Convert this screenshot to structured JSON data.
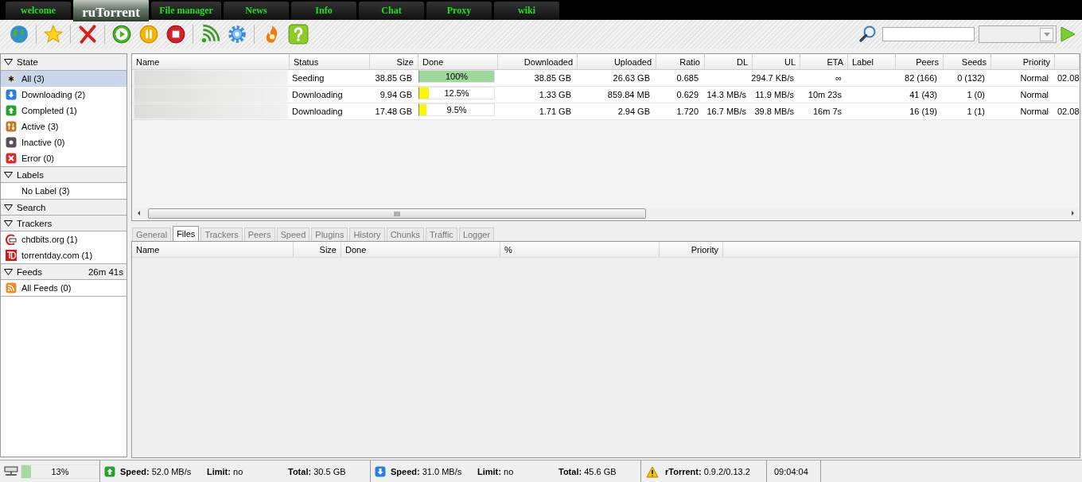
{
  "top_tabs": [
    {
      "label": "welcome",
      "selected": false
    },
    {
      "label": "ruTorrent",
      "selected": true
    },
    {
      "label": "File manager",
      "selected": false
    },
    {
      "label": "News",
      "selected": false
    },
    {
      "label": "Info",
      "selected": false
    },
    {
      "label": "Chat",
      "selected": false
    },
    {
      "label": "Proxy",
      "selected": false
    },
    {
      "label": "wiki",
      "selected": false
    }
  ],
  "sidebar": [
    {
      "title": "State",
      "expanded": true,
      "items": [
        {
          "kind": "all",
          "label": "All (3)",
          "selected": true
        },
        {
          "kind": "downloading",
          "label": "Downloading (2)",
          "selected": false
        },
        {
          "kind": "completed",
          "label": "Completed (1)",
          "selected": false
        },
        {
          "kind": "active",
          "label": "Active (3)",
          "selected": false
        },
        {
          "kind": "inactive",
          "label": "Inactive (0)",
          "selected": false
        },
        {
          "kind": "error",
          "label": "Error (0)",
          "selected": false
        }
      ]
    },
    {
      "title": "Labels",
      "expanded": true,
      "items": [
        {
          "kind": "label",
          "label": "No Label (3)",
          "selected": false
        }
      ]
    },
    {
      "title": "Search",
      "expanded": true
    },
    {
      "title": "Trackers",
      "expanded": true,
      "items": [
        {
          "kind": "tracker-c",
          "label": "chdbits.org (1)",
          "selected": false
        },
        {
          "kind": "tracker-t",
          "label": "torrentday.com (1)",
          "selected": false
        }
      ]
    },
    {
      "title": "Feeds",
      "expanded": true,
      "timer": "26m 41s",
      "items": [
        {
          "kind": "rss",
          "label": "All Feeds (0)",
          "selected": false
        }
      ]
    }
  ],
  "torrents": {
    "columns": [
      "Name",
      "Status",
      "Size",
      "Done",
      "Downloaded",
      "Uploaded",
      "Ratio",
      "DL",
      "UL",
      "ETA",
      "Label",
      "Peers",
      "Seeds",
      "Priority"
    ],
    "rows": [
      {
        "status": "Seeding",
        "size": "38.85 GB",
        "done": {
          "level": 1,
          "text": "100%"
        },
        "downloaded": "38.85 GB",
        "uploaded": "26.63 GB",
        "ratio": "0.685",
        "ul": "294.7 KB/s",
        "eta": "∞",
        "peers": "82 (166)",
        "seeds": "0 (132)",
        "priority": "Normal",
        "column_15": "02.08"
      },
      {
        "status": "Downloading",
        "size": "9.94 GB",
        "done": {
          "level": 0.125,
          "text": "12.5%"
        },
        "downloaded": "1.33 GB",
        "uploaded": "859.84 MB",
        "ratio": "0.629",
        "dl": "14.3 MB/s",
        "ul": "11.9 MB/s",
        "eta": "10m 23s",
        "peers": "41 (43)",
        "seeds": "1 (0)",
        "priority": "Normal"
      },
      {
        "status": "Downloading",
        "size": "17.48 GB",
        "done": {
          "level": 0.095,
          "text": "9.5%"
        },
        "downloaded": "1.71 GB",
        "uploaded": "2.94 GB",
        "ratio": "1.720",
        "dl": "16.7 MB/s",
        "ul": "39.8 MB/s",
        "eta": "16m 7s",
        "peers": "16 (19)",
        "seeds": "1 (1)",
        "priority": "Normal",
        "column_15": "02.08"
      }
    ]
  },
  "detail_tabs": [
    {
      "label": "General",
      "selected": false
    },
    {
      "label": "Files",
      "selected": true
    },
    {
      "label": "Trackers",
      "selected": false
    },
    {
      "label": "Peers",
      "selected": false
    },
    {
      "label": "Speed",
      "selected": false
    },
    {
      "label": "Plugins",
      "selected": false
    },
    {
      "label": "History",
      "selected": false
    },
    {
      "label": "Chunks",
      "selected": false
    },
    {
      "label": "Traffic",
      "selected": false
    },
    {
      "label": "Logger",
      "selected": false
    }
  ],
  "files": {
    "columns": [
      "Name",
      "Size",
      "Done",
      "%",
      "Priority"
    ]
  },
  "status_bar": {
    "disk": {
      "level": 0.13,
      "text": "13%"
    },
    "upload": {
      "speed": "**Speed:** 52.0 MB/s",
      "limit": "**Limit:** no",
      "total": "**Total:** 30.5 GB"
    },
    "download": {
      "speed": "**Speed:** 31.0 MB/s",
      "limit": "**Limit:** no",
      "total": "**Total:** 45.6 GB"
    },
    "version": "**rTorrent:** 0.9.2/0.13.2",
    "time": "09:04:04"
  }
}
